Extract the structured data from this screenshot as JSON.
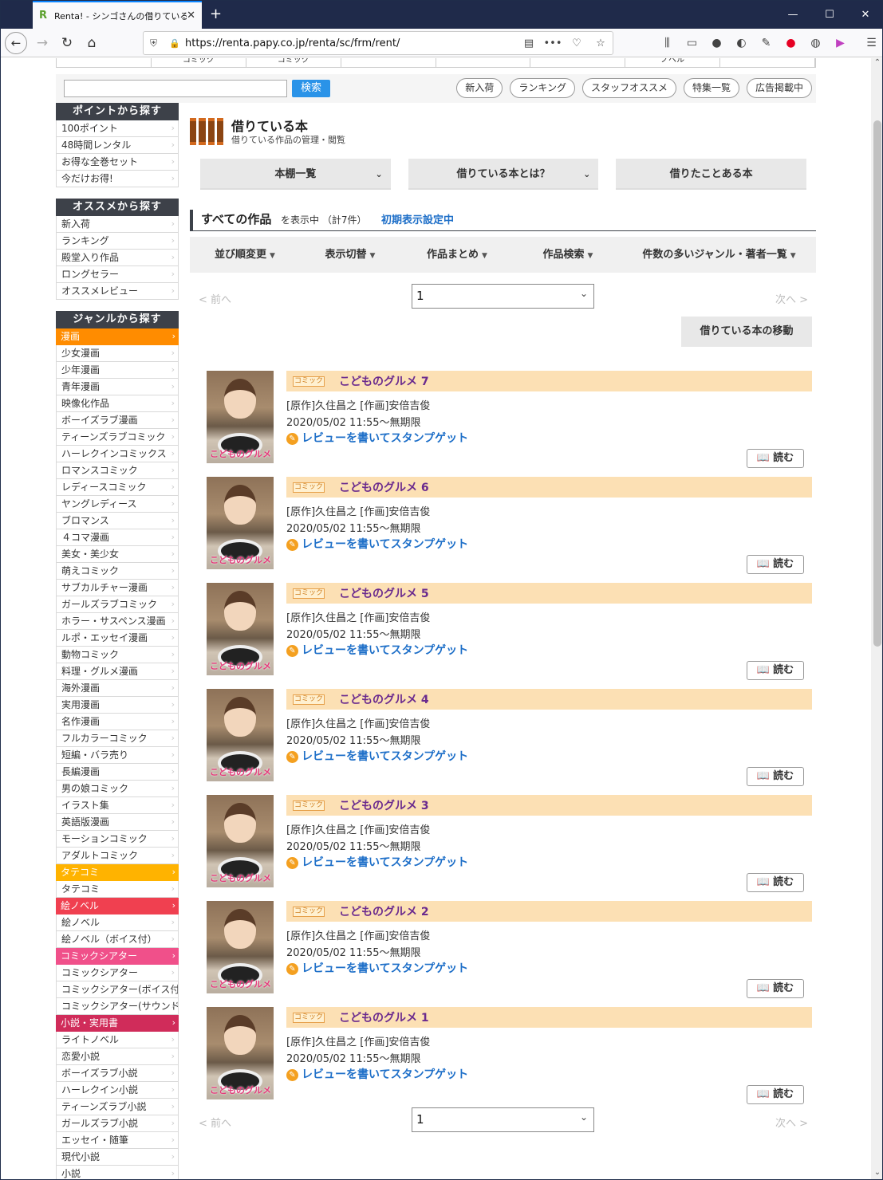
{
  "browser": {
    "tab_title": "Renta! - シンゴさんの借りている本",
    "tab_close": "✕",
    "new_tab": "+",
    "url": "https://renta.papy.co.jp/renta/sc/frm/rent/",
    "url_more": "•••"
  },
  "global_nav": [
    "",
    "コミック",
    "コミック",
    "",
    "",
    "",
    "ノベル",
    ""
  ],
  "search": {
    "placeholder": "",
    "button": "検索"
  },
  "top_pills": [
    "新入荷",
    "ランキング",
    "スタッフオススメ",
    "特集一覧",
    "広告掲載中"
  ],
  "sidebar": [
    {
      "title": "ポイントから探す",
      "items": [
        {
          "label": "100ポイント"
        },
        {
          "label": "48時間レンタル"
        },
        {
          "label": "お得な全巻セット"
        },
        {
          "label": "今だけお得!"
        }
      ]
    },
    {
      "title": "オススメから探す",
      "items": [
        {
          "label": "新入荷"
        },
        {
          "label": "ランキング"
        },
        {
          "label": "殿堂入り作品"
        },
        {
          "label": "ロングセラー"
        },
        {
          "label": "オススメレビュー"
        }
      ]
    },
    {
      "title": "ジャンルから探す",
      "items": [
        {
          "label": "漫画",
          "cat": "#ff8c00"
        },
        {
          "label": "少女漫画"
        },
        {
          "label": "少年漫画"
        },
        {
          "label": "青年漫画"
        },
        {
          "label": "映像化作品"
        },
        {
          "label": "ボーイズラブ漫画"
        },
        {
          "label": "ティーンズラブコミック"
        },
        {
          "label": "ハーレクインコミックス"
        },
        {
          "label": "ロマンスコミック"
        },
        {
          "label": "レディースコミック"
        },
        {
          "label": "ヤングレディース"
        },
        {
          "label": "ブロマンス"
        },
        {
          "label": "４コマ漫画"
        },
        {
          "label": "美女・美少女"
        },
        {
          "label": "萌えコミック"
        },
        {
          "label": "サブカルチャー漫画"
        },
        {
          "label": "ガールズラブコミック"
        },
        {
          "label": "ホラー・サスペンス漫画"
        },
        {
          "label": "ルポ・エッセイ漫画"
        },
        {
          "label": "動物コミック"
        },
        {
          "label": "料理・グルメ漫画"
        },
        {
          "label": "海外漫画"
        },
        {
          "label": "実用漫画"
        },
        {
          "label": "名作漫画"
        },
        {
          "label": "フルカラーコミック"
        },
        {
          "label": "短編・バラ売り"
        },
        {
          "label": "長編漫画"
        },
        {
          "label": "男の娘コミック"
        },
        {
          "label": "イラスト集"
        },
        {
          "label": "英語版漫画"
        },
        {
          "label": "モーションコミック"
        },
        {
          "label": "アダルトコミック"
        },
        {
          "label": "タテコミ",
          "cat": "#ffb300"
        },
        {
          "label": "タテコミ"
        },
        {
          "label": "絵ノベル",
          "cat": "#f04050"
        },
        {
          "label": "絵ノベル"
        },
        {
          "label": "絵ノベル（ボイス付）"
        },
        {
          "label": "コミックシアター",
          "cat": "#f0508a"
        },
        {
          "label": "コミックシアター"
        },
        {
          "label": "コミックシアター(ボイス付)"
        },
        {
          "label": "コミックシアター(サウンド付)"
        },
        {
          "label": "小説・実用書",
          "cat": "#d02c5a"
        },
        {
          "label": "ライトノベル"
        },
        {
          "label": "恋愛小説"
        },
        {
          "label": "ボーイズラブ小説"
        },
        {
          "label": "ハーレクイン小説"
        },
        {
          "label": "ティーンズラブ小説"
        },
        {
          "label": "ガールズラブ小説"
        },
        {
          "label": "エッセイ・随筆"
        },
        {
          "label": "現代小説"
        },
        {
          "label": "小説"
        }
      ]
    }
  ],
  "page": {
    "title": "借りている本",
    "subtitle": "借りている作品の管理・閲覧",
    "tabs": [
      "本棚一覧",
      "借りている本とは？",
      "借りたことある本"
    ],
    "all_works": "すべての作品",
    "display_suffix": "を表示中 （計7件）",
    "default_setting": "初期表示設定中",
    "sort_menu": [
      "並び順変更",
      "表示切替",
      "作品まとめ",
      "作品検索",
      "件数の多いジャンル・著者一覧"
    ],
    "prev": "< 前へ",
    "next": "次へ >",
    "page_value": "1",
    "move_button": "借りている本の移動"
  },
  "books": [
    {
      "badge": "コミック",
      "title": "こどものグルメ 7",
      "authors": "[原作]久住昌之 [作画]安倍吉俊",
      "date": "2020/05/02 11:55～無期限",
      "review": "レビューを書いてスタンプゲット",
      "read": "読む",
      "cover_text": "こどものグルメ"
    },
    {
      "badge": "コミック",
      "title": "こどものグルメ 6",
      "authors": "[原作]久住昌之 [作画]安倍吉俊",
      "date": "2020/05/02 11:55～無期限",
      "review": "レビューを書いてスタンプゲット",
      "read": "読む",
      "cover_text": "こどものグルメ"
    },
    {
      "badge": "コミック",
      "title": "こどものグルメ 5",
      "authors": "[原作]久住昌之 [作画]安倍吉俊",
      "date": "2020/05/02 11:55～無期限",
      "review": "レビューを書いてスタンプゲット",
      "read": "読む",
      "cover_text": "こどものグルメ"
    },
    {
      "badge": "コミック",
      "title": "こどものグルメ 4",
      "authors": "[原作]久住昌之 [作画]安倍吉俊",
      "date": "2020/05/02 11:55～無期限",
      "review": "レビューを書いてスタンプゲット",
      "read": "読む",
      "cover_text": "こどものグルメ"
    },
    {
      "badge": "コミック",
      "title": "こどものグルメ 3",
      "authors": "[原作]久住昌之 [作画]安倍吉俊",
      "date": "2020/05/02 11:55～無期限",
      "review": "レビューを書いてスタンプゲット",
      "read": "読む",
      "cover_text": "こどものグルメ"
    },
    {
      "badge": "コミック",
      "title": "こどものグルメ 2",
      "authors": "[原作]久住昌之 [作画]安倍吉俊",
      "date": "2020/05/02 11:55～無期限",
      "review": "レビューを書いてスタンプゲット",
      "read": "読む",
      "cover_text": "こどものグルメ"
    },
    {
      "badge": "コミック",
      "title": "こどものグルメ 1",
      "authors": "[原作]久住昌之 [作画]安倍吉俊",
      "date": "2020/05/02 11:55～無期限",
      "review": "レビューを書いてスタンプゲット",
      "read": "読む",
      "cover_text": "こどものグルメ"
    }
  ]
}
